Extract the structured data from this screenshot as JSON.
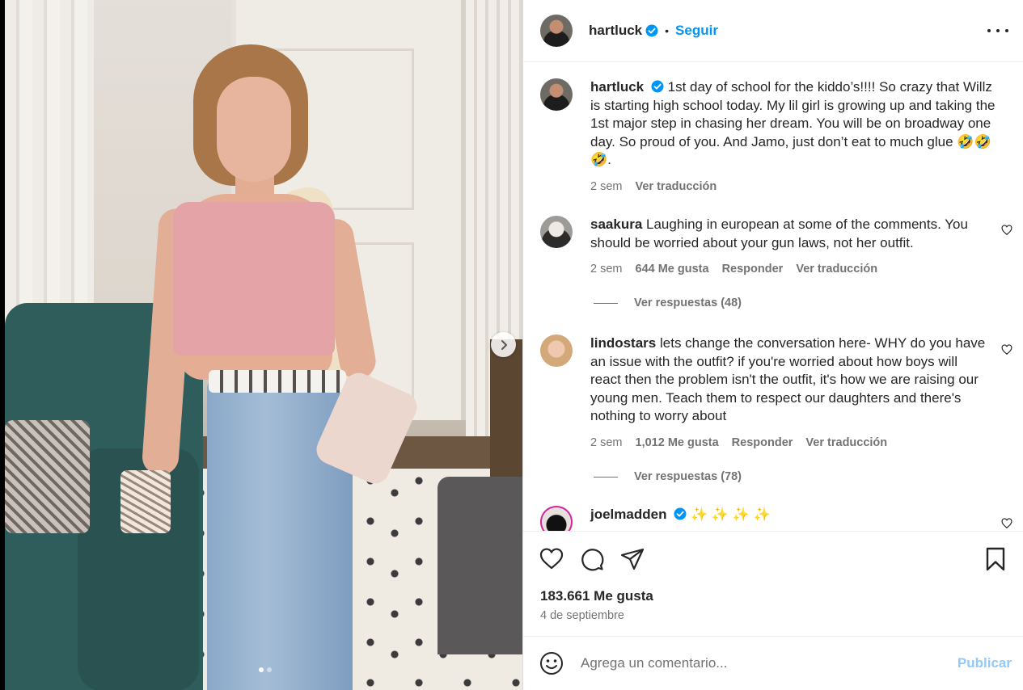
{
  "post": {
    "author": "hartluck",
    "follow_label": "Seguir",
    "separator": "•",
    "caption": "1st day of school for the kiddo’s!!!! So crazy that Willz is starting high school today. My lil girl is growing up and taking the 1st major step in chasing her dream. You will be on broadway one day. So proud of you. And Jamo, just don’t eat to much glue 🤣🤣🤣.",
    "caption_time": "2 sem",
    "caption_translate": "Ver traducción",
    "likes": "183.661 Me gusta",
    "date": "4 de septiembre",
    "carousel": {
      "total": 2,
      "current": 1
    }
  },
  "comments": [
    {
      "user": "saakura",
      "text": "Laughing in european at some of the comments. You should be worried about your gun laws, not her outfit.",
      "time": "2 sem",
      "likes": "644 Me gusta",
      "reply": "Responder",
      "translate": "Ver traducción",
      "replies": "Ver respuestas (48)"
    },
    {
      "user": "lindostars",
      "text": "lets change the conversation here- WHY do you have an issue with the outfit? if you're worried about how boys will react then the problem isn't the outfit, it's how we are raising our young men. Teach them to respect our daughters and there's nothing to worry about",
      "time": "2 sem",
      "likes": "1,012 Me gusta",
      "reply": "Responder",
      "translate": "Ver traducción",
      "replies": "Ver respuestas (78)"
    },
    {
      "user": "joelmadden",
      "verified": true,
      "text": "✨ ✨ ✨ ✨"
    }
  ],
  "composer": {
    "placeholder": "Agrega un comentario...",
    "publish_label": "Publicar"
  },
  "icons": {
    "more": "more-options-icon",
    "like": "heart-icon",
    "comment": "comment-icon",
    "share": "share-icon",
    "save": "bookmark-icon",
    "emoji": "emoji-icon",
    "next": "chevron-right-icon",
    "verified": "verified-badge-icon"
  },
  "colors": {
    "accent": "#0095f6",
    "publish_disabled": "#92c9f9",
    "secondary_text": "#737373",
    "verified": "#0095f6"
  }
}
